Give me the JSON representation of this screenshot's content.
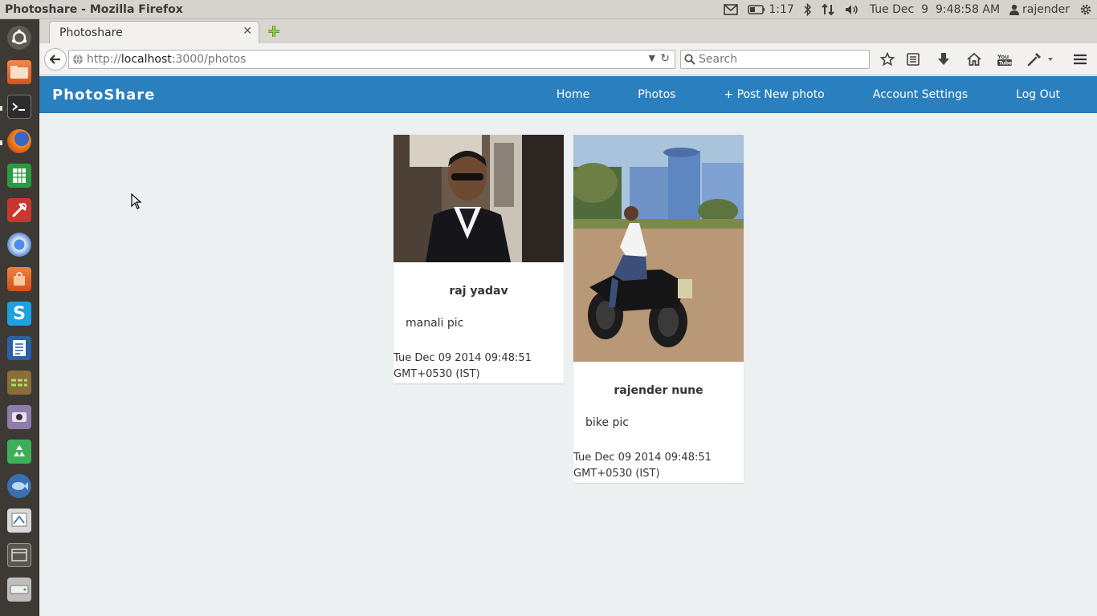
{
  "window": {
    "title": "Photoshare - Mozilla Firefox"
  },
  "panel": {
    "battery": "1:17",
    "datetime": "Tue Dec  9  9:48:58 AM",
    "user": "rajender",
    "icons": [
      "mail-icon",
      "battery-icon",
      "bluetooth-icon",
      "network-icon",
      "volume-icon",
      "user-icon",
      "gear-icon"
    ]
  },
  "launcher": {
    "items": [
      "dash",
      "files",
      "terminal",
      "firefox",
      "spreadsheet",
      "settings",
      "chromium",
      "app-store",
      "skype",
      "writer",
      "workspaces",
      "camera",
      "recycle",
      "fish",
      "drawing",
      "window",
      "disk"
    ]
  },
  "browser": {
    "tab_title": "Photoshare",
    "url_scheme": "http://",
    "url_host": "localhost",
    "url_path": ":3000/photos",
    "search_placeholder": "Search"
  },
  "app": {
    "brand": "PhotoShare",
    "nav": [
      "Home",
      "Photos",
      "+ Post New photo",
      "Account Settings",
      "Log Out"
    ]
  },
  "photos": [
    {
      "name": "raj yadav",
      "description": "manali pic",
      "date": "Tue Dec 09 2014 09:48:51 GMT+0530 (IST)"
    },
    {
      "name": "rajender nune",
      "description": "bike pic",
      "date": "Tue Dec 09 2014 09:48:51 GMT+0530 (IST)"
    }
  ],
  "colors": {
    "navbar": "#2a7fbf",
    "page_bg": "#ecf0f1",
    "launcher": "#3d3a35"
  }
}
